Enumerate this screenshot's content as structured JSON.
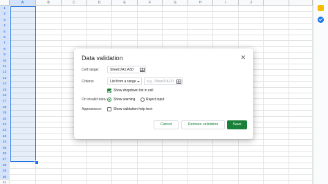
{
  "spreadsheet": {
    "columns": [
      "A",
      "B",
      "C",
      "D",
      "E",
      "F",
      "G",
      "H",
      "I",
      "J"
    ],
    "rows": [
      "1",
      "2",
      "3",
      "4",
      "5",
      "6",
      "7",
      "8",
      "9",
      "10",
      "11",
      "12",
      "13",
      "14",
      "15",
      "16",
      "17",
      "18",
      "19",
      "20",
      "21",
      "22",
      "23",
      "24",
      "25",
      "26",
      "27",
      "28",
      "29",
      "30",
      "31"
    ],
    "selected_column": "A",
    "selected_range_rows": 30
  },
  "dialog": {
    "title": "Data validation",
    "cell_range_label": "Cell range:",
    "cell_range_value": "Sheet1!A1:A30",
    "criteria_label": "Criteria:",
    "criteria_option": "List from a range",
    "criteria_placeholder": "e.g., Sheet1!A2:D",
    "show_dropdown_label": "Show dropdown list in cell",
    "show_dropdown_checked": true,
    "on_invalid_label": "On invalid data:",
    "show_warning_label": "Show warning",
    "reject_input_label": "Reject input",
    "selected_invalid_option": "Show warning",
    "appearance_label": "Appearance:",
    "show_help_text_label": "Show validation help text:",
    "show_help_text_checked": false,
    "cancel_label": "Cancel",
    "remove_label": "Remove validation",
    "save_label": "Save"
  },
  "side_panel": {
    "icons": [
      "keep-icon",
      "tasks-icon"
    ]
  },
  "colors": {
    "accent": "#188038",
    "selection": "#1a73e8"
  }
}
